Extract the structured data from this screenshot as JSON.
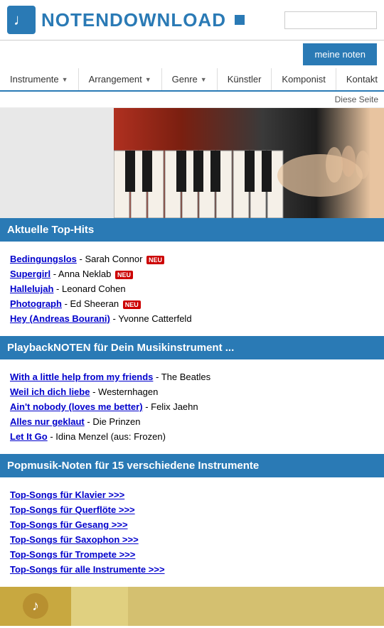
{
  "header": {
    "logo_text": "NOTENDOWNLOAD",
    "search_placeholder": "",
    "meine_noten_label": "meine noten"
  },
  "nav": {
    "items": [
      {
        "label": "Instrumente",
        "has_arrow": true
      },
      {
        "label": "Arrangement",
        "has_arrow": true
      },
      {
        "label": "Genre",
        "has_arrow": true
      },
      {
        "label": "Künstler",
        "has_arrow": false
      },
      {
        "label": "Komponist",
        "has_arrow": false
      },
      {
        "label": "Kontakt",
        "has_arrow": false
      }
    ]
  },
  "diese_seite": "Diese Seite",
  "sections": {
    "top_hits": {
      "header": "Aktuelle Top-Hits",
      "items": [
        {
          "title": "Bedingungslos",
          "artist": "Sarah Connor",
          "neu": true
        },
        {
          "title": "Supergirl",
          "artist": "Anna Neklab",
          "neu": true
        },
        {
          "title": "Hallelujah",
          "artist": "Leonard Cohen",
          "neu": false
        },
        {
          "title": "Photograph",
          "artist": "Ed Sheeran",
          "neu": true
        },
        {
          "title": "Hey (Andreas Bourani)",
          "artist": "Yvonne Catterfeld",
          "neu": false
        }
      ]
    },
    "playback": {
      "header": "PlaybackNOTEN für Dein Musikinstrument ...",
      "items": [
        {
          "title": "With a little help from my friends",
          "artist": "The Beatles"
        },
        {
          "title": "Weil ich dich liebe",
          "artist": "Westernhagen"
        },
        {
          "title": "Ain't nobody (loves me better)",
          "artist": "Felix Jaehn"
        },
        {
          "title": "Alles nur geklaut",
          "artist": "Die Prinzen"
        },
        {
          "title": "Let It Go",
          "artist": "Idina Menzel (aus: Frozen)"
        }
      ]
    },
    "top_songs": {
      "header": "Popmusik-Noten für 15 verschiedene Instrumente",
      "links": [
        "Top-Songs für Klavier >>>",
        "Top-Songs für Querflöte >>>",
        "Top-Songs für Gesang >>>",
        "Top-Songs für Saxophon >>>",
        "Top-Songs für Trompete >>>",
        "Top-Songs für alle Instrumente >>>"
      ]
    }
  }
}
